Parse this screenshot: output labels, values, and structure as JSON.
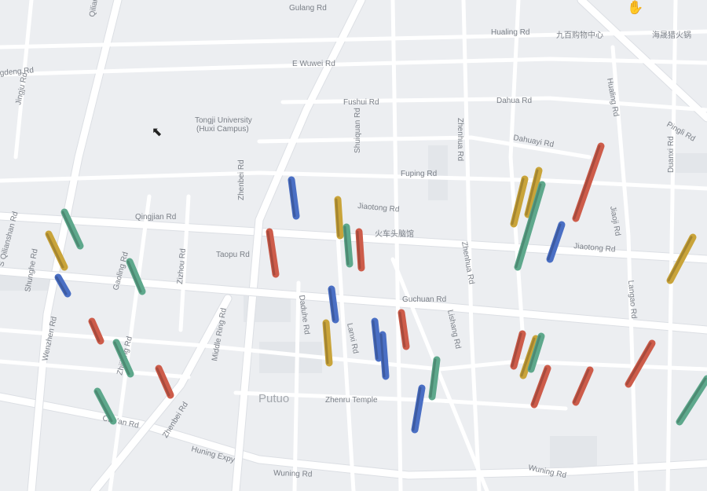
{
  "labels": {
    "gulang": "Gulang Rd",
    "hualing": "Hualing Rd",
    "jiubai": "九百购物中心",
    "haisheng": "海晟猎火锅",
    "ewuwei": "E Wuwei Rd",
    "fushui": "Fushui Rd",
    "dahua": "Dahua Rd",
    "hualingrd_v": "Hualing Rd",
    "tongji1": "Tongji University",
    "tongji2": "(Huxi Campus)",
    "shuiquan": "Shuiquan Rd",
    "zhenhua_top": "Zhenhua Rd",
    "dahuayi": "Dahuayi Rd",
    "pingli": "Pingli Rd",
    "duanxi": "Duanxi Rd",
    "zhenbei_top": "Zhenbei Rd",
    "fuping": "Fuping Rd",
    "jiaotong1": "Jiaotong Rd",
    "jiaotong2": "Jiaotong Rd",
    "jiaojie": "Jiaoji Rd",
    "qingjian": "Qingjian Rd",
    "huochetou": "火车头脑馆",
    "taopu": "Taopu Rd",
    "qilianshan": "S Qilianshan Rd",
    "shunghe": "Shunghe Rd",
    "gaoling": "Gaoling Rd",
    "zizhou": "Zizhou Rd",
    "middlering": "Middle Ring Rd",
    "zhenhua_mid": "Zhenhua Rd",
    "langao": "Langao Rd",
    "daduhe": "Daduhe Rd",
    "guchuan": "Guchuan Rd",
    "lanxi": "Lanxi Rd",
    "lishang": "Lishang Rd",
    "wenzhen": "Wenzhen Rd",
    "zhijiang": "Zhijiang Rd",
    "putuo": "Putuo",
    "zhenru": "Zhenru Temple",
    "zhenbei_bot": "Zhenbei Rd",
    "caoyang": "Cao'an Rd",
    "huning": "Huning Expy",
    "wuning1": "Wuning Rd",
    "wuning2": "Wuning Rd",
    "jingjiu": "Jingju Rd",
    "gedeng": "gdeng Rd",
    "qilian_top": "Qilian"
  },
  "layer": {
    "type": "column",
    "colors": {
      "green": "#5ea88c",
      "yellow": "#c9a43a",
      "blue": "#4a6fc4",
      "red": "#cd5c4a"
    }
  },
  "icons": {
    "cursor": "arrow-cursor-icon",
    "hand": "grab-hand-icon"
  }
}
